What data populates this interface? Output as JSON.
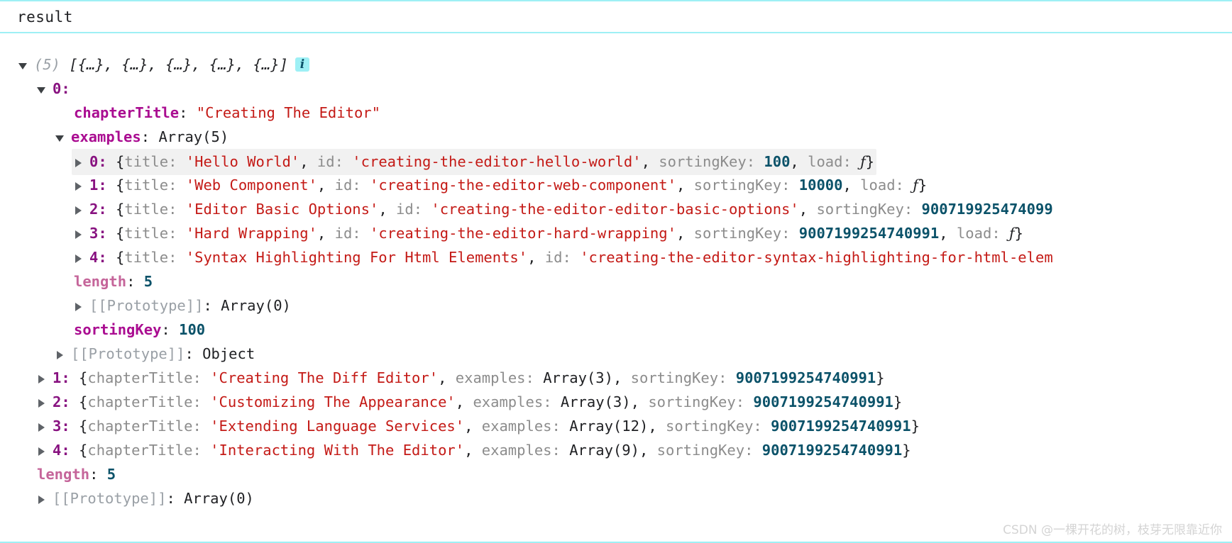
{
  "header": {
    "title": "result",
    "accent_color": "#9ef0f5"
  },
  "colors": {
    "string": "#c41a16",
    "number": "#0b5269",
    "property": "#aa0d91",
    "index": "#881280",
    "dim_key": "#8c8c8c",
    "prototype": "#9aa0a6",
    "highlight_row": "#f1f1f1",
    "badge_background": "#9ef0f5"
  },
  "tree": {
    "root": {
      "count": "(5)",
      "preview": "[{…}, {…}, {…}, {…}, {…}]",
      "badge": "i",
      "expanded": true
    },
    "item0": {
      "index": "0:",
      "chapterTitle_key": "chapterTitle",
      "chapterTitle_value": "\"Creating The Editor\"",
      "examples_key": "examples",
      "examples_value": "Array(5)",
      "sortingKey_key": "sortingKey",
      "sortingKey_value": "100",
      "prototype_key": "[[Prototype]]",
      "prototype_value": "Object"
    },
    "examples": {
      "length_key": "length",
      "length_value": "5",
      "prototype_key": "[[Prototype]]",
      "prototype_value": "Array(0)",
      "rows": [
        {
          "index": "0:",
          "title_key": "title",
          "title_value": "'Hello World'",
          "id_key": "id",
          "id_value": "'creating-the-editor-hello-world'",
          "sortingKey_key": "sortingKey",
          "sortingKey_value": "100",
          "load_key": "load",
          "load_value": "ƒ",
          "highlighted": true,
          "closing": "}"
        },
        {
          "index": "1:",
          "title_key": "title",
          "title_value": "'Web Component'",
          "id_key": "id",
          "id_value": "'creating-the-editor-web-component'",
          "sortingKey_key": "sortingKey",
          "sortingKey_value": "10000",
          "load_key": "load",
          "load_value": "ƒ",
          "highlighted": false,
          "closing": "}"
        },
        {
          "index": "2:",
          "title_key": "title",
          "title_value": "'Editor Basic Options'",
          "id_key": "id",
          "id_value": "'creating-the-editor-editor-basic-options'",
          "sortingKey_key": "sortingKey",
          "sortingKey_value": "900719925474099",
          "load_key": "",
          "load_value": "",
          "highlighted": false,
          "closing": ""
        },
        {
          "index": "3:",
          "title_key": "title",
          "title_value": "'Hard Wrapping'",
          "id_key": "id",
          "id_value": "'creating-the-editor-hard-wrapping'",
          "sortingKey_key": "sortingKey",
          "sortingKey_value": "9007199254740991",
          "load_key": "load",
          "load_value": "ƒ",
          "highlighted": false,
          "closing": "}"
        },
        {
          "index": "4:",
          "title_key": "title",
          "title_value": "'Syntax Highlighting For Html Elements'",
          "id_key": "id",
          "id_value": "'creating-the-editor-syntax-highlighting-for-html-elem",
          "sortingKey_key": "",
          "sortingKey_value": "",
          "load_key": "",
          "load_value": "",
          "highlighted": false,
          "closing": ""
        }
      ]
    },
    "siblings": [
      {
        "index": "1:",
        "chapterTitle_key": "chapterTitle",
        "chapterTitle_value": "'Creating The Diff Editor'",
        "examples_key": "examples",
        "examples_value": "Array(3)",
        "sortingKey_key": "sortingKey",
        "sortingKey_value": "9007199254740991",
        "closing": "}"
      },
      {
        "index": "2:",
        "chapterTitle_key": "chapterTitle",
        "chapterTitle_value": "'Customizing The Appearance'",
        "examples_key": "examples",
        "examples_value": "Array(3)",
        "sortingKey_key": "sortingKey",
        "sortingKey_value": "9007199254740991",
        "closing": "}"
      },
      {
        "index": "3:",
        "chapterTitle_key": "chapterTitle",
        "chapterTitle_value": "'Extending Language Services'",
        "examples_key": "examples",
        "examples_value": "Array(12)",
        "sortingKey_key": "sortingKey",
        "sortingKey_value": "9007199254740991",
        "closing": "}"
      },
      {
        "index": "4:",
        "chapterTitle_key": "chapterTitle",
        "chapterTitle_value": "'Interacting With The Editor'",
        "examples_key": "examples",
        "examples_value": "Array(9)",
        "sortingKey_key": "sortingKey",
        "sortingKey_value": "9007199254740991",
        "closing": "}"
      }
    ],
    "root_tail": {
      "length_key": "length",
      "length_value": "5",
      "prototype_key": "[[Prototype]]",
      "prototype_value": "Array(0)"
    }
  },
  "punctuation": {
    "colon": ":",
    "comma": ",",
    "open_brace": "{",
    "close_brace": "}"
  },
  "watermark": "CSDN @一棵开花的树，枝芽无限靠近你"
}
